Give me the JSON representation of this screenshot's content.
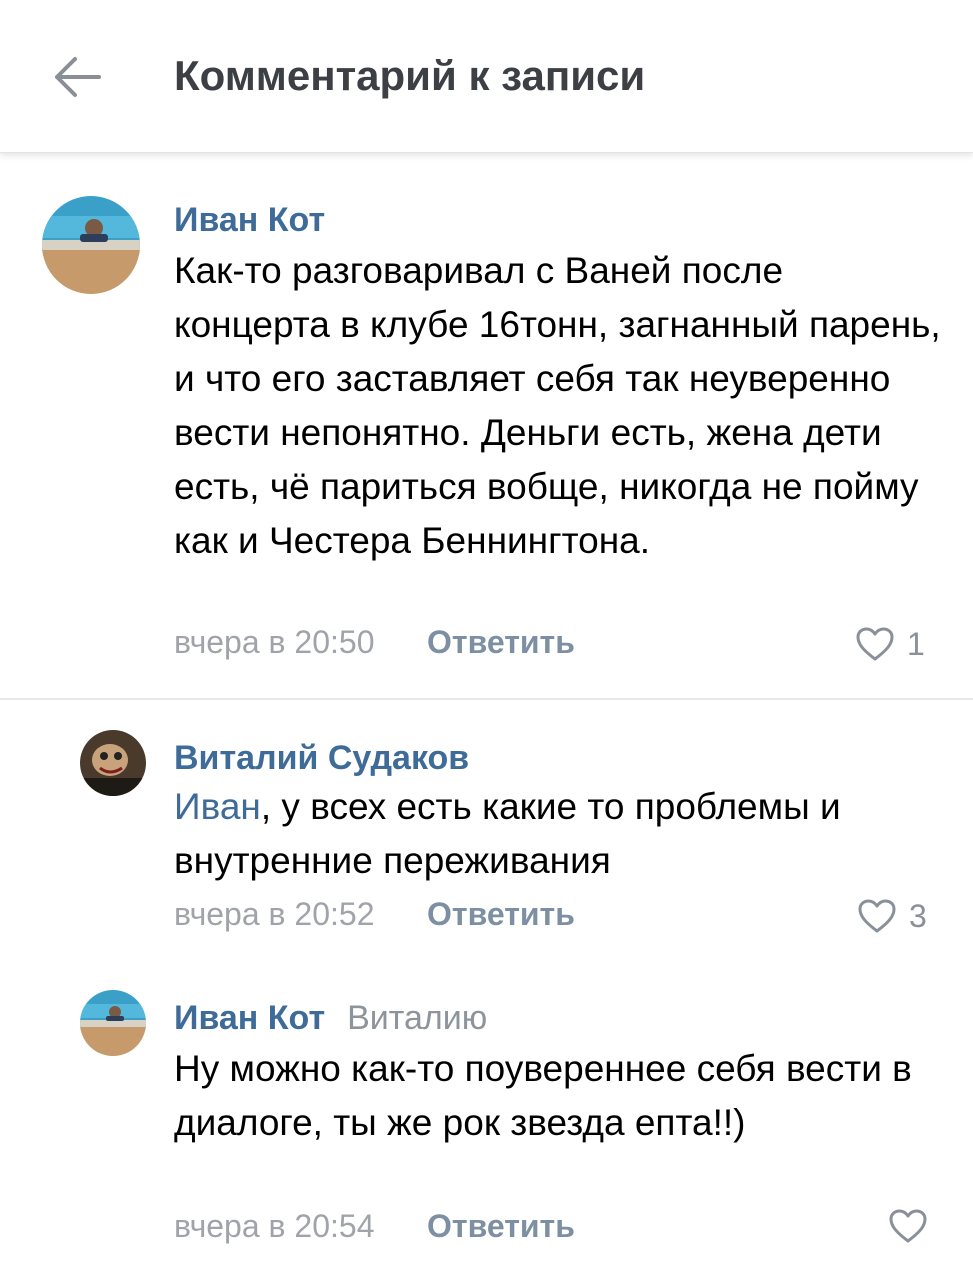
{
  "header": {
    "title": "Комментарий к записи",
    "back_icon": "arrow-left-icon"
  },
  "colors": {
    "author": "#3f6b99",
    "meta": "#a0a4aa",
    "reply_link": "#7d8fa3",
    "like_icon": "#8a9099"
  },
  "comments": [
    {
      "author": "Иван Кот",
      "text": "Как-то разговаривал с Ваней после концерта в клубе 16тонн, загнанный парень, и что его заставляет себя так неуверенно вести непонятно. Деньги есть, жена дети есть, чё париться вобще, никогда не пойму как и Честера Беннингтона.",
      "time": "вчера в 20:50",
      "reply_label": "Ответить",
      "likes": "1"
    },
    {
      "author": "Виталий Судаков",
      "mention": "Иван",
      "text": ", у всех есть какие то проблемы и внутренние переживания",
      "time": "вчера в 20:52",
      "reply_label": "Ответить",
      "likes": "3"
    },
    {
      "author": "Иван Кот",
      "reply_to": "Виталию",
      "text": "Ну можно как-то поувереннее себя вести в диалоге, ты же рок звезда епта!!)",
      "time": "вчера в 20:54",
      "reply_label": "Ответить",
      "likes": ""
    }
  ]
}
